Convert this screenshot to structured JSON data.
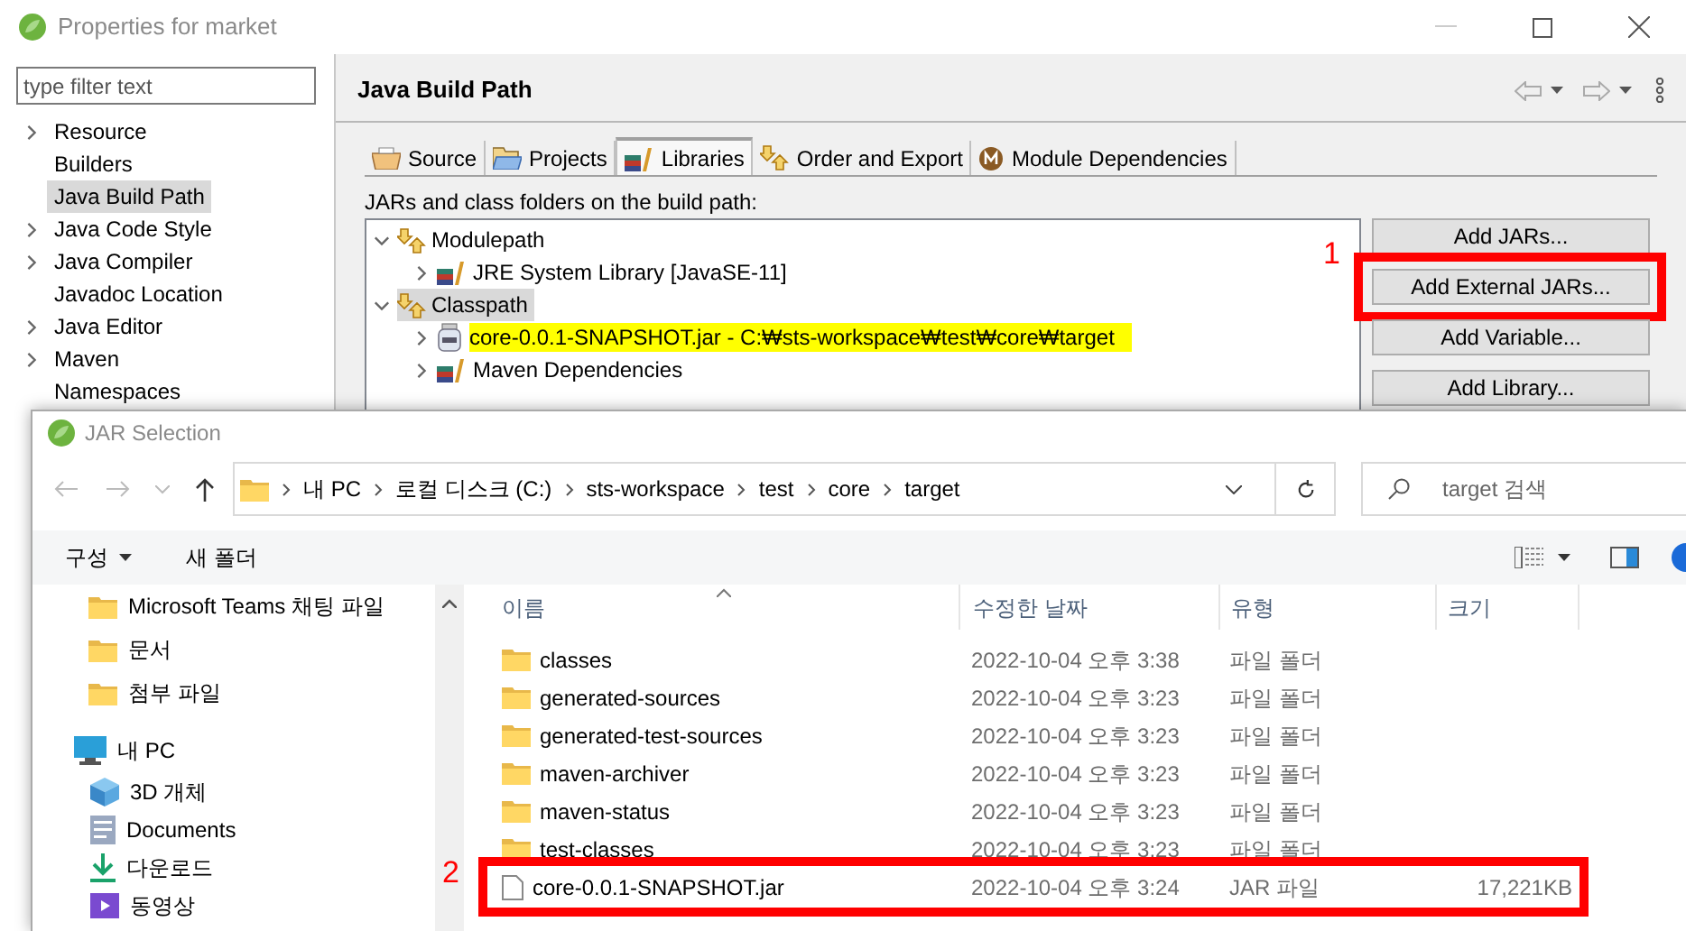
{
  "properties_window": {
    "title": "Properties for market",
    "filter_placeholder": "type filter text",
    "nav": [
      {
        "label": "Resource",
        "expandable": true,
        "selected": false
      },
      {
        "label": "Builders",
        "expandable": false,
        "selected": false
      },
      {
        "label": "Java Build Path",
        "expandable": false,
        "selected": true
      },
      {
        "label": "Java Code Style",
        "expandable": true,
        "selected": false
      },
      {
        "label": "Java Compiler",
        "expandable": true,
        "selected": false
      },
      {
        "label": "Javadoc Location",
        "expandable": false,
        "selected": false
      },
      {
        "label": "Java Editor",
        "expandable": true,
        "selected": false
      },
      {
        "label": "Maven",
        "expandable": true,
        "selected": false
      },
      {
        "label": "Namespaces",
        "expandable": false,
        "selected": false
      }
    ],
    "page_title": "Java Build Path",
    "tabs": [
      {
        "label": "Source",
        "kind": "source",
        "selected": false
      },
      {
        "label": "Projects",
        "kind": "projects",
        "selected": false
      },
      {
        "label": "Libraries",
        "kind": "libraries",
        "selected": true
      },
      {
        "label": "Order and Export",
        "kind": "order",
        "selected": false
      },
      {
        "label": "Module Dependencies",
        "kind": "module",
        "selected": false
      }
    ],
    "description": "JARs and class folders on the build path:",
    "tree": [
      {
        "label": "Modulepath",
        "expanded": true,
        "selected": false,
        "children": [
          {
            "label": "JRE System Library [JavaSE-11]",
            "kind": "library",
            "highlighted": false
          }
        ]
      },
      {
        "label": "Classpath",
        "expanded": true,
        "selected": true,
        "children": [
          {
            "label": "core-0.0.1-SNAPSHOT.jar - C:₩sts-workspace₩test₩core₩target",
            "kind": "jar",
            "highlighted": true
          },
          {
            "label": "Maven Dependencies",
            "kind": "library",
            "highlighted": false
          }
        ]
      }
    ],
    "buttons": [
      {
        "label": "Add JARs..."
      },
      {
        "label": "Add External JARs...",
        "annotation": "1"
      },
      {
        "label": "Add Variable..."
      },
      {
        "label": "Add Library..."
      }
    ]
  },
  "jar_dialog": {
    "title": "JAR Selection",
    "breadcrumb": [
      "내 PC",
      "로컬 디스크 (C:)",
      "sts-workspace",
      "test",
      "core",
      "target"
    ],
    "search_placeholder": "target 검색",
    "toolbar": [
      {
        "label": "구성",
        "dropdown": true
      },
      {
        "label": "새 폴더",
        "dropdown": false
      }
    ],
    "nav_pane": [
      {
        "label": "Microsoft Teams 채팅 파일",
        "kind": "folder"
      },
      {
        "label": "문서",
        "kind": "folder"
      },
      {
        "label": "첨부 파일",
        "kind": "folder"
      },
      {
        "label": "내 PC",
        "kind": "pc",
        "children": [
          {
            "label": "3D 개체",
            "kind": "cube"
          },
          {
            "label": "Documents",
            "kind": "doc"
          },
          {
            "label": "다운로드",
            "kind": "download"
          },
          {
            "label": "동영상",
            "kind": "video"
          }
        ]
      }
    ],
    "columns": [
      "이름",
      "수정한 날짜",
      "유형",
      "크기"
    ],
    "files": [
      {
        "name": "classes",
        "modified": "2022-10-04 오후 3:38",
        "type": "파일 폴더",
        "kind": "folder"
      },
      {
        "name": "generated-sources",
        "modified": "2022-10-04 오후 3:23",
        "type": "파일 폴더",
        "kind": "folder"
      },
      {
        "name": "generated-test-sources",
        "modified": "2022-10-04 오후 3:23",
        "type": "파일 폴더",
        "kind": "folder"
      },
      {
        "name": "maven-archiver",
        "modified": "2022-10-04 오후 3:23",
        "type": "파일 폴더",
        "kind": "folder"
      },
      {
        "name": "maven-status",
        "modified": "2022-10-04 오후 3:23",
        "type": "파일 폴더",
        "kind": "folder"
      },
      {
        "name": "test-classes",
        "modified": "2022-10-04 오후 3:23",
        "type": "파일 폴더",
        "kind": "folder"
      },
      {
        "name": "core-0.0.1-SNAPSHOT.jar",
        "modified": "2022-10-04 오후 3:24",
        "type": "JAR 파일",
        "size": "17,221KB",
        "kind": "file",
        "annotation": "2"
      }
    ]
  }
}
